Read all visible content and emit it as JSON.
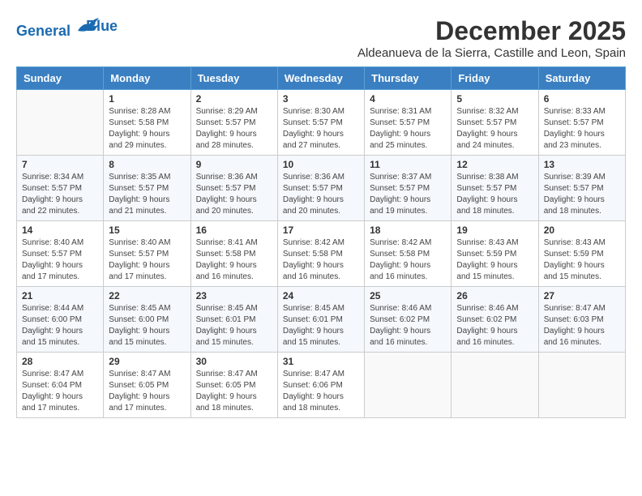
{
  "logo": {
    "line1": "General",
    "line2": "Blue"
  },
  "title": "December 2025",
  "subtitle": "Aldeanueva de la Sierra, Castille and Leon, Spain",
  "days_of_week": [
    "Sunday",
    "Monday",
    "Tuesday",
    "Wednesday",
    "Thursday",
    "Friday",
    "Saturday"
  ],
  "weeks": [
    [
      {
        "day": "",
        "sunrise": "",
        "sunset": "",
        "daylight": ""
      },
      {
        "day": "1",
        "sunrise": "Sunrise: 8:28 AM",
        "sunset": "Sunset: 5:58 PM",
        "daylight": "Daylight: 9 hours and 29 minutes."
      },
      {
        "day": "2",
        "sunrise": "Sunrise: 8:29 AM",
        "sunset": "Sunset: 5:57 PM",
        "daylight": "Daylight: 9 hours and 28 minutes."
      },
      {
        "day": "3",
        "sunrise": "Sunrise: 8:30 AM",
        "sunset": "Sunset: 5:57 PM",
        "daylight": "Daylight: 9 hours and 27 minutes."
      },
      {
        "day": "4",
        "sunrise": "Sunrise: 8:31 AM",
        "sunset": "Sunset: 5:57 PM",
        "daylight": "Daylight: 9 hours and 25 minutes."
      },
      {
        "day": "5",
        "sunrise": "Sunrise: 8:32 AM",
        "sunset": "Sunset: 5:57 PM",
        "daylight": "Daylight: 9 hours and 24 minutes."
      },
      {
        "day": "6",
        "sunrise": "Sunrise: 8:33 AM",
        "sunset": "Sunset: 5:57 PM",
        "daylight": "Daylight: 9 hours and 23 minutes."
      }
    ],
    [
      {
        "day": "7",
        "sunrise": "Sunrise: 8:34 AM",
        "sunset": "Sunset: 5:57 PM",
        "daylight": "Daylight: 9 hours and 22 minutes."
      },
      {
        "day": "8",
        "sunrise": "Sunrise: 8:35 AM",
        "sunset": "Sunset: 5:57 PM",
        "daylight": "Daylight: 9 hours and 21 minutes."
      },
      {
        "day": "9",
        "sunrise": "Sunrise: 8:36 AM",
        "sunset": "Sunset: 5:57 PM",
        "daylight": "Daylight: 9 hours and 20 minutes."
      },
      {
        "day": "10",
        "sunrise": "Sunrise: 8:36 AM",
        "sunset": "Sunset: 5:57 PM",
        "daylight": "Daylight: 9 hours and 20 minutes."
      },
      {
        "day": "11",
        "sunrise": "Sunrise: 8:37 AM",
        "sunset": "Sunset: 5:57 PM",
        "daylight": "Daylight: 9 hours and 19 minutes."
      },
      {
        "day": "12",
        "sunrise": "Sunrise: 8:38 AM",
        "sunset": "Sunset: 5:57 PM",
        "daylight": "Daylight: 9 hours and 18 minutes."
      },
      {
        "day": "13",
        "sunrise": "Sunrise: 8:39 AM",
        "sunset": "Sunset: 5:57 PM",
        "daylight": "Daylight: 9 hours and 18 minutes."
      }
    ],
    [
      {
        "day": "14",
        "sunrise": "Sunrise: 8:40 AM",
        "sunset": "Sunset: 5:57 PM",
        "daylight": "Daylight: 9 hours and 17 minutes."
      },
      {
        "day": "15",
        "sunrise": "Sunrise: 8:40 AM",
        "sunset": "Sunset: 5:57 PM",
        "daylight": "Daylight: 9 hours and 17 minutes."
      },
      {
        "day": "16",
        "sunrise": "Sunrise: 8:41 AM",
        "sunset": "Sunset: 5:58 PM",
        "daylight": "Daylight: 9 hours and 16 minutes."
      },
      {
        "day": "17",
        "sunrise": "Sunrise: 8:42 AM",
        "sunset": "Sunset: 5:58 PM",
        "daylight": "Daylight: 9 hours and 16 minutes."
      },
      {
        "day": "18",
        "sunrise": "Sunrise: 8:42 AM",
        "sunset": "Sunset: 5:58 PM",
        "daylight": "Daylight: 9 hours and 16 minutes."
      },
      {
        "day": "19",
        "sunrise": "Sunrise: 8:43 AM",
        "sunset": "Sunset: 5:59 PM",
        "daylight": "Daylight: 9 hours and 15 minutes."
      },
      {
        "day": "20",
        "sunrise": "Sunrise: 8:43 AM",
        "sunset": "Sunset: 5:59 PM",
        "daylight": "Daylight: 9 hours and 15 minutes."
      }
    ],
    [
      {
        "day": "21",
        "sunrise": "Sunrise: 8:44 AM",
        "sunset": "Sunset: 6:00 PM",
        "daylight": "Daylight: 9 hours and 15 minutes."
      },
      {
        "day": "22",
        "sunrise": "Sunrise: 8:45 AM",
        "sunset": "Sunset: 6:00 PM",
        "daylight": "Daylight: 9 hours and 15 minutes."
      },
      {
        "day": "23",
        "sunrise": "Sunrise: 8:45 AM",
        "sunset": "Sunset: 6:01 PM",
        "daylight": "Daylight: 9 hours and 15 minutes."
      },
      {
        "day": "24",
        "sunrise": "Sunrise: 8:45 AM",
        "sunset": "Sunset: 6:01 PM",
        "daylight": "Daylight: 9 hours and 15 minutes."
      },
      {
        "day": "25",
        "sunrise": "Sunrise: 8:46 AM",
        "sunset": "Sunset: 6:02 PM",
        "daylight": "Daylight: 9 hours and 16 minutes."
      },
      {
        "day": "26",
        "sunrise": "Sunrise: 8:46 AM",
        "sunset": "Sunset: 6:02 PM",
        "daylight": "Daylight: 9 hours and 16 minutes."
      },
      {
        "day": "27",
        "sunrise": "Sunrise: 8:47 AM",
        "sunset": "Sunset: 6:03 PM",
        "daylight": "Daylight: 9 hours and 16 minutes."
      }
    ],
    [
      {
        "day": "28",
        "sunrise": "Sunrise: 8:47 AM",
        "sunset": "Sunset: 6:04 PM",
        "daylight": "Daylight: 9 hours and 17 minutes."
      },
      {
        "day": "29",
        "sunrise": "Sunrise: 8:47 AM",
        "sunset": "Sunset: 6:05 PM",
        "daylight": "Daylight: 9 hours and 17 minutes."
      },
      {
        "day": "30",
        "sunrise": "Sunrise: 8:47 AM",
        "sunset": "Sunset: 6:05 PM",
        "daylight": "Daylight: 9 hours and 18 minutes."
      },
      {
        "day": "31",
        "sunrise": "Sunrise: 8:47 AM",
        "sunset": "Sunset: 6:06 PM",
        "daylight": "Daylight: 9 hours and 18 minutes."
      },
      {
        "day": "",
        "sunrise": "",
        "sunset": "",
        "daylight": ""
      },
      {
        "day": "",
        "sunrise": "",
        "sunset": "",
        "daylight": ""
      },
      {
        "day": "",
        "sunrise": "",
        "sunset": "",
        "daylight": ""
      }
    ]
  ]
}
